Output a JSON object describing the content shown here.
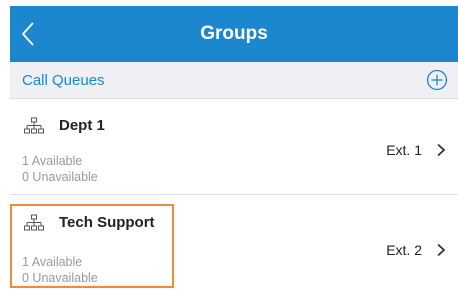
{
  "header": {
    "title": "Groups",
    "back_icon": "chevron-left-icon",
    "background": "#1c87cf"
  },
  "section": {
    "title": "Call Queues",
    "add_icon": "plus-circle-icon"
  },
  "queues": [
    {
      "name": "Dept 1",
      "available": "1 Available",
      "unavailable": "0 Unavailable",
      "ext": "Ext. 1"
    },
    {
      "name": "Tech Support",
      "available": "1 Available",
      "unavailable": "0 Unavailable",
      "ext": "Ext. 2"
    }
  ],
  "colors": {
    "accent": "#1c87cf",
    "highlight": "#f28a34"
  }
}
